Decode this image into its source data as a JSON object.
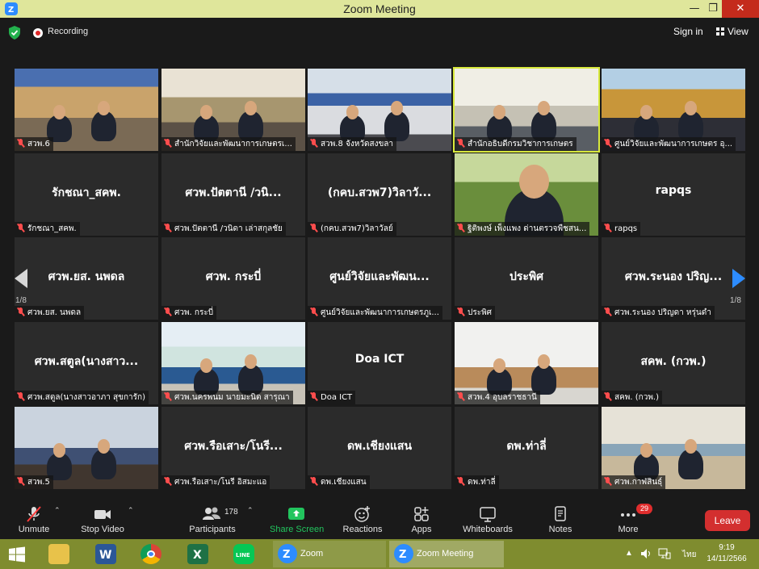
{
  "window": {
    "title": "Zoom Meeting",
    "minimize_glyph": "—",
    "maximize_glyph": "❐",
    "close_glyph": "✕"
  },
  "topbar": {
    "recording_label": "Recording",
    "signin_label": "Sign in",
    "view_label": "View"
  },
  "gallery": {
    "page_left": "1/8",
    "page_right": "1/8",
    "tiles": [
      {
        "caption": "สวพ.6",
        "big": "",
        "video": true
      },
      {
        "caption": "สำนักวิจัยและพัฒนาการเกษตรเ...",
        "big": "",
        "video": true
      },
      {
        "caption": "สวพ.8 จังหวัดสงขลา",
        "big": "",
        "video": true
      },
      {
        "caption": "สำนักอธิบดีกรมวิชาการเกษตร",
        "big": "",
        "video": true,
        "active": true
      },
      {
        "caption": "ศูนย์วิจัยและพัฒนาการเกษตร อุ...",
        "big": "",
        "video": true
      },
      {
        "caption": "รักชณา_สคพ.",
        "big": "รักชณา_สคพ."
      },
      {
        "caption": "ศวพ.ปัตตานี /วนิดา เล่าสกุลชัย",
        "big": "ศวพ.ปัตตานี /วนิ..."
      },
      {
        "caption": "(กคบ.สวพ7)วิลาวัลย์",
        "big": "(กคบ.สวพ7)วิลาวั..."
      },
      {
        "caption": "ฐิติพงษ์ เพ็งแพง ด่านตรวจพืชสน...",
        "big": "",
        "video": true
      },
      {
        "caption": "rapqs",
        "big": "rapqs"
      },
      {
        "caption": "ศวพ.ยส. นพดล",
        "big": "ศวพ.ยส. นพดล"
      },
      {
        "caption": "ศวพ. กระบี่",
        "big": "ศวพ. กระบี่"
      },
      {
        "caption": "ศูนย์วิจัยและพัฒนาการเกษตรภูเ...",
        "big": "ศูนย์วิจัยและพัฒน..."
      },
      {
        "caption": "ประพิศ",
        "big": "ประพิศ"
      },
      {
        "caption": "ศวพ.ระนอง ปริญดา หรุ่นดำ",
        "big": "ศวพ.ระนอง ปริญ..."
      },
      {
        "caption": "ศวพ.สตูล(นางสาวอาภา สุขการัก)",
        "big": "ศวพ.สตูล(นางสาว..."
      },
      {
        "caption": "ศวพ.นครพนม นายมะนิต สารุณา",
        "big": "",
        "video": true
      },
      {
        "caption": "Doa ICT",
        "big": "Doa ICT"
      },
      {
        "caption": "สวพ.4 อุบลราชธานี",
        "big": "",
        "video": true
      },
      {
        "caption": "สคพ. (กวพ.)",
        "big": "สคพ. (กวพ.)"
      },
      {
        "caption": "สวพ.5",
        "big": "",
        "video": true
      },
      {
        "caption": "ศวพ.รือเสาะ/โนรี อิสมะแอ",
        "big": "ศวพ.รือเสาะ/โนรี..."
      },
      {
        "caption": "ดพ.เชียงแสน",
        "big": "ดพ.เชียงแสน"
      },
      {
        "caption": "ดพ.ท่าลี่",
        "big": "ดพ.ท่าลี่"
      },
      {
        "caption": "ศวพ.กาฬสินธุ์",
        "big": "",
        "video": true
      }
    ]
  },
  "toolbar": {
    "unmute_label": "Unmute",
    "stop_video_label": "Stop Video",
    "participants_label": "Participants",
    "participants_count": "178",
    "share_label": "Share Screen",
    "reactions_label": "Reactions",
    "apps_label": "Apps",
    "whiteboards_label": "Whiteboards",
    "notes_label": "Notes",
    "more_label": "More",
    "more_badge": "29",
    "leave_label": "Leave",
    "share_color": "#22c55e",
    "leave_color": "#d32f2f"
  },
  "taskbar": {
    "zoom_label": "Zoom",
    "zoom_meeting_label": "Zoom Meeting",
    "lang": "ไทย",
    "time": "9:19",
    "date": "14/11/2566",
    "tray_glyphs": "▲"
  },
  "colors": {
    "titlebar": "#dfe69b",
    "taskbar": "#7f8c2f",
    "active_outline": "#d8e93c",
    "zoom_blue": "#2d8cff"
  }
}
